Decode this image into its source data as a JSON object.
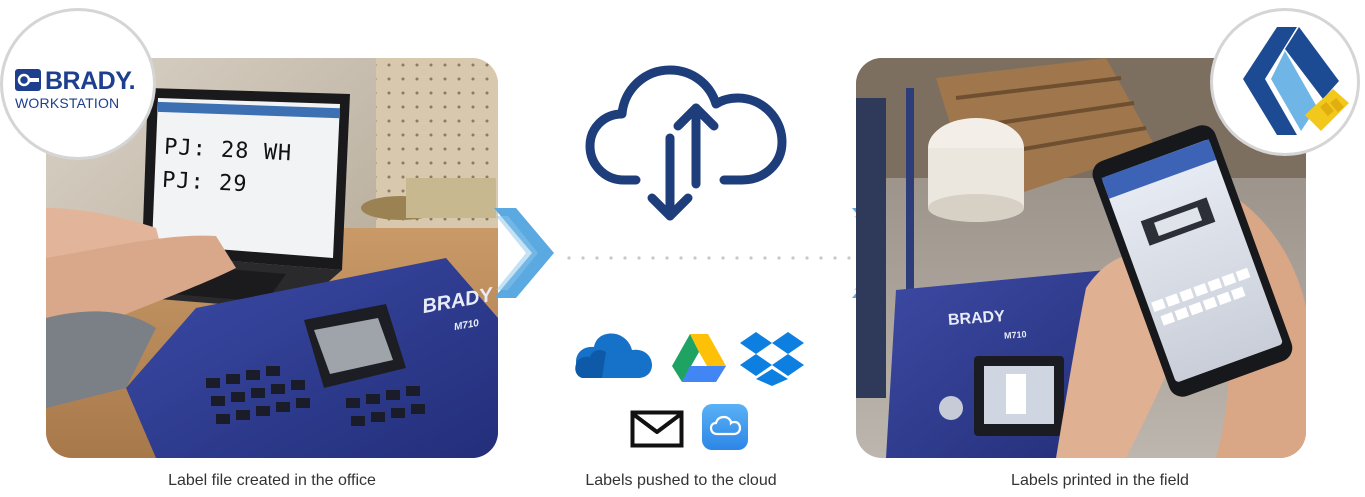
{
  "left_panel": {
    "caption": "Label file created in the office",
    "badge_brand": "BRADY.",
    "badge_sub": "WORKSTATION",
    "screen_line1": "PJ: 28 WH",
    "screen_line2": "PJ: 29",
    "printer_brand": "BRADY",
    "printer_model": "M710"
  },
  "middle_panel": {
    "caption": "Labels pushed to the cloud",
    "services": [
      "onedrive-icon",
      "google-drive-icon",
      "dropbox-icon",
      "email-icon",
      "icloud-icon"
    ]
  },
  "right_panel": {
    "caption": "Labels printed in the field",
    "printer_brand": "BRADY",
    "printer_model": "M710"
  },
  "colors": {
    "brand_navy": "#1d3f8e",
    "arrow_blue": "#5aa9e0",
    "cloud_navy": "#1e3d7b",
    "onedrive": "#1671c8",
    "icloud": "#3d9ef0"
  }
}
